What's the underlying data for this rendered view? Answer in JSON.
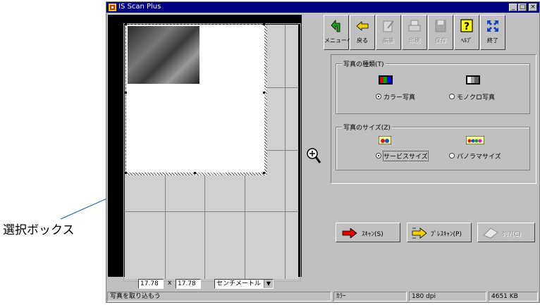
{
  "callout": {
    "label": "選択ボックス"
  },
  "window": {
    "title": "IS Scan Plus",
    "controls": {
      "minimize": "_",
      "maximize": "□",
      "close": "×"
    }
  },
  "size_fields": {
    "width": "17.78",
    "separator": "x",
    "height": "17.78",
    "unit": "センチメートル"
  },
  "toolbar": {
    "items": [
      {
        "label": "メニューへ",
        "icon": "back-to-menu-icon",
        "enabled": true
      },
      {
        "label": "戻る",
        "icon": "back-arrow-icon",
        "enabled": true
      },
      {
        "label": "編集",
        "icon": "edit-icon",
        "enabled": false
      },
      {
        "label": "印刷",
        "icon": "print-icon",
        "enabled": false
      },
      {
        "label": "保存",
        "icon": "save-icon",
        "enabled": false
      },
      {
        "label": "ﾍﾙﾌﾟ",
        "icon": "help-icon",
        "enabled": true
      },
      {
        "label": "終了",
        "icon": "exit-icon",
        "enabled": true
      }
    ]
  },
  "photo_type": {
    "legend": "写真の種類(T)",
    "options": [
      {
        "label": "カラー写真",
        "selected": true,
        "icon": "color-photo-icon"
      },
      {
        "label": "モノクロ写真",
        "selected": false,
        "icon": "mono-photo-icon"
      }
    ]
  },
  "photo_size": {
    "legend": "写真のサイズ(Z)",
    "options": [
      {
        "label": "サービスサイズ",
        "selected": true,
        "icon": "service-size-icon"
      },
      {
        "label": "パノラマサイズ",
        "selected": false,
        "icon": "panorama-size-icon"
      }
    ]
  },
  "actions": {
    "scan": "ｽｷｬﾝ(S)",
    "prescan": "ﾌﾟﾚｽｷｬﾝ(P)",
    "clear": "ｸﾘｱ(C)"
  },
  "status": {
    "message": "写真を取り込もう",
    "mode": "ｶﾗｰ",
    "resolution": "180 dpi",
    "size": "4651 KB"
  },
  "colors": {
    "titlebar": "#000080",
    "face": "#c0c0c0",
    "scan_arrow": "#e00000",
    "prescan_arrow": "#f0d000",
    "callout_line": "#1f5ba8"
  }
}
